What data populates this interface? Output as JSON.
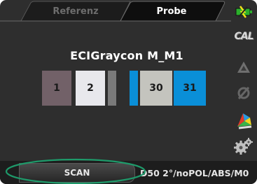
{
  "tabs": {
    "reference_label": "Referenz",
    "probe_label": "Probe"
  },
  "measurement": {
    "title": "ECIGraycon M_M1"
  },
  "patches_left": [
    {
      "number": "1",
      "color": "#726168"
    },
    {
      "number": "2",
      "color": "#e8e8ec"
    }
  ],
  "patches_right": [
    {
      "number": "30",
      "color": "#c4c4be"
    },
    {
      "number": "31",
      "color": "#0a8fd8"
    }
  ],
  "sidebar": {
    "icons": [
      "battery-connection-icon",
      "calibration-icon",
      "triangle-icon",
      "no-polarization-icon",
      "color-wheel-icon",
      "settings-gear-icon"
    ],
    "cal_label": "CAL"
  },
  "bottom_bar": {
    "scan_label": "SCAN",
    "status_text": "D50 2°/noPOL/ABS/M0"
  },
  "colors": {
    "accent_blue": "#0a8fd8",
    "highlight_ellipse": "#1e9a6a"
  }
}
